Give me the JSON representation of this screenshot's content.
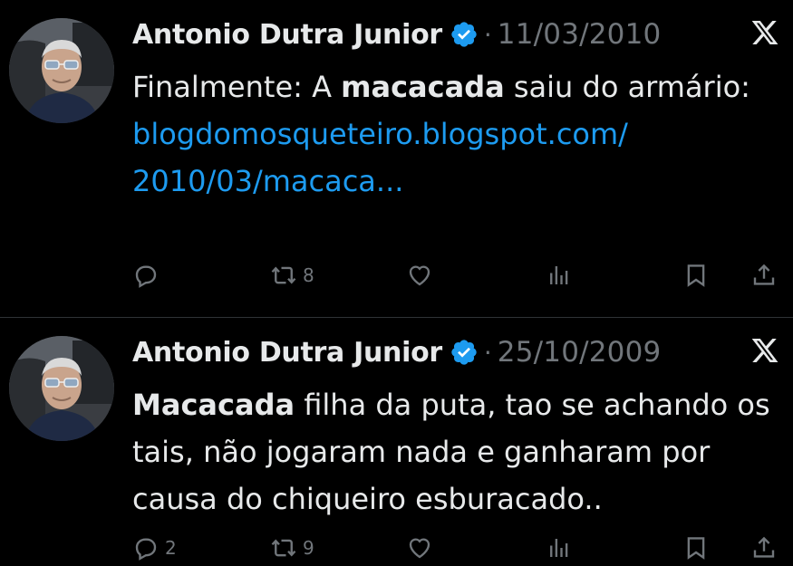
{
  "tweets": [
    {
      "author": "Antonio Dutra Junior",
      "separator": "·",
      "date": "11/03/2010",
      "text_prefix": "Finalmente: A ",
      "text_bold": "macacada",
      "text_suffix": " saiu do armário:",
      "link_line1": "blogdomosqueteiro.blogspot.com/",
      "link_line2": "2010/03/macaca...",
      "replies": "",
      "retweets": "8",
      "likes": "",
      "views": ""
    },
    {
      "author": "Antonio Dutra Junior",
      "separator": "·",
      "date": "25/10/2009",
      "text_bold": "Macacada",
      "text_suffix": " filha da puta, tao se achando os tais, não jogaram nada e ganharam por causa do chiqueiro esburacado..",
      "replies": "2",
      "retweets": "9",
      "likes": "",
      "views": ""
    }
  ],
  "icons": {
    "verified": "verified-badge-icon",
    "x_logo": "x-logo-icon",
    "reply": "reply-icon",
    "retweet": "retweet-icon",
    "like": "heart-icon",
    "views": "views-icon",
    "bookmark": "bookmark-icon",
    "share": "share-icon"
  },
  "colors": {
    "background": "#000000",
    "text": "#e7e9ea",
    "muted": "#71767b",
    "link": "#1d9bf0",
    "verified": "#1d9bf0"
  }
}
